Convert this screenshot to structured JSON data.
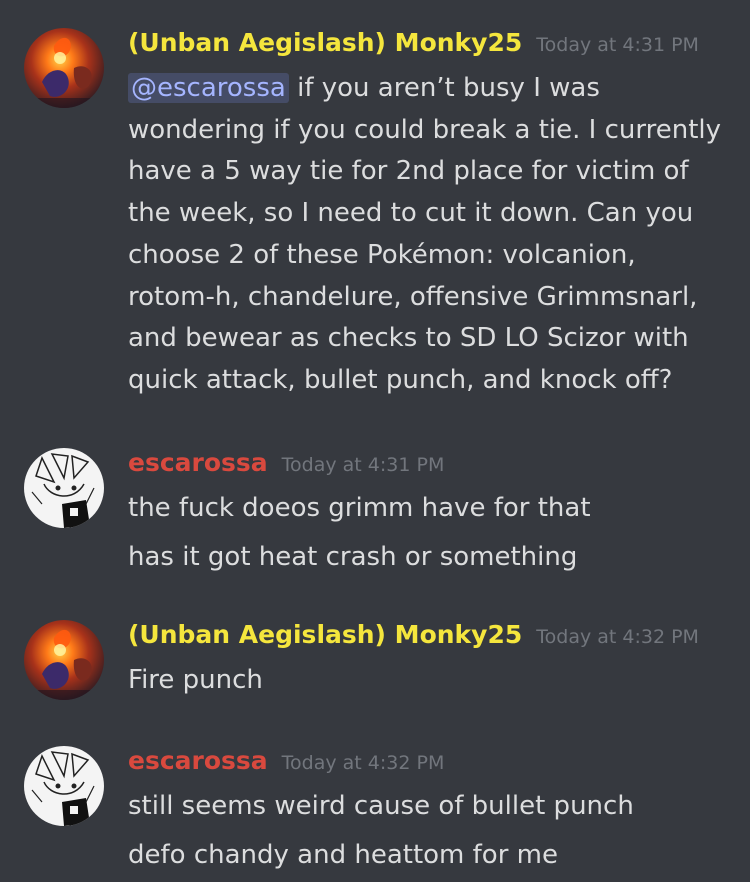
{
  "colors": {
    "background": "#36393f",
    "monky_name": "#f5e63d",
    "escarossa_name": "#d9493e",
    "timestamp": "#72767d",
    "text": "#dcddde",
    "mention": "#a5b5ff"
  },
  "messages": [
    {
      "author": "(Unban Aegislash) Monky25",
      "time": "Today at 4:31 PM",
      "mention": "@escarossa",
      "lines": [
        " if you aren’t busy I was",
        "wondering if you could break a tie. I currently",
        "have a 5 way tie for 2nd place for victim of",
        "the week, so I need to cut it down. Can you",
        "choose 2 of these Pokémon: volcanion,",
        "rotom-h, chandelure, offensive Grimmsnarl,",
        "and bewear as checks to SD LO Scizor with",
        "quick attack, bullet punch, and knock off?"
      ]
    },
    {
      "author": "escarossa",
      "time": "Today at 4:31 PM",
      "lines": [
        "the fuck doeos grimm have for that",
        "has it got heat crash or something"
      ]
    },
    {
      "author": "(Unban Aegislash) Monky25",
      "time": "Today at 4:32 PM",
      "lines": [
        "Fire punch"
      ]
    },
    {
      "author": "escarossa",
      "time": "Today at 4:32 PM",
      "lines": [
        "still seems weird cause of bullet punch",
        "defo chandy and heattom for me"
      ]
    }
  ]
}
